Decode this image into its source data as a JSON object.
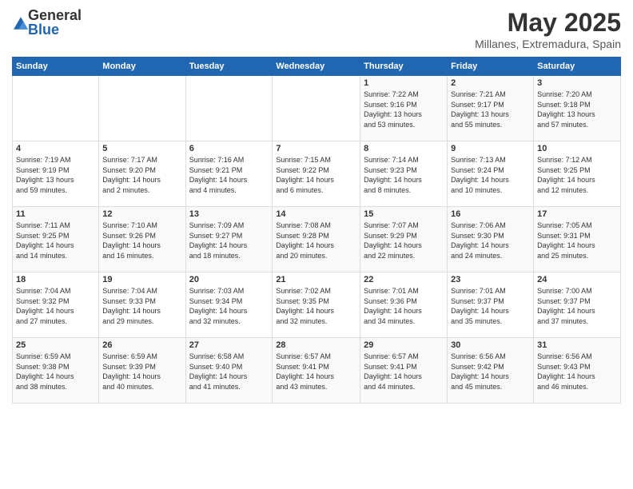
{
  "header": {
    "logo_general": "General",
    "logo_blue": "Blue",
    "month": "May 2025",
    "location": "Millanes, Extremadura, Spain"
  },
  "days_of_week": [
    "Sunday",
    "Monday",
    "Tuesday",
    "Wednesday",
    "Thursday",
    "Friday",
    "Saturday"
  ],
  "weeks": [
    [
      {
        "day": "",
        "content": ""
      },
      {
        "day": "",
        "content": ""
      },
      {
        "day": "",
        "content": ""
      },
      {
        "day": "",
        "content": ""
      },
      {
        "day": "1",
        "content": "Sunrise: 7:22 AM\nSunset: 9:16 PM\nDaylight: 13 hours\nand 53 minutes."
      },
      {
        "day": "2",
        "content": "Sunrise: 7:21 AM\nSunset: 9:17 PM\nDaylight: 13 hours\nand 55 minutes."
      },
      {
        "day": "3",
        "content": "Sunrise: 7:20 AM\nSunset: 9:18 PM\nDaylight: 13 hours\nand 57 minutes."
      }
    ],
    [
      {
        "day": "4",
        "content": "Sunrise: 7:19 AM\nSunset: 9:19 PM\nDaylight: 13 hours\nand 59 minutes."
      },
      {
        "day": "5",
        "content": "Sunrise: 7:17 AM\nSunset: 9:20 PM\nDaylight: 14 hours\nand 2 minutes."
      },
      {
        "day": "6",
        "content": "Sunrise: 7:16 AM\nSunset: 9:21 PM\nDaylight: 14 hours\nand 4 minutes."
      },
      {
        "day": "7",
        "content": "Sunrise: 7:15 AM\nSunset: 9:22 PM\nDaylight: 14 hours\nand 6 minutes."
      },
      {
        "day": "8",
        "content": "Sunrise: 7:14 AM\nSunset: 9:23 PM\nDaylight: 14 hours\nand 8 minutes."
      },
      {
        "day": "9",
        "content": "Sunrise: 7:13 AM\nSunset: 9:24 PM\nDaylight: 14 hours\nand 10 minutes."
      },
      {
        "day": "10",
        "content": "Sunrise: 7:12 AM\nSunset: 9:25 PM\nDaylight: 14 hours\nand 12 minutes."
      }
    ],
    [
      {
        "day": "11",
        "content": "Sunrise: 7:11 AM\nSunset: 9:25 PM\nDaylight: 14 hours\nand 14 minutes."
      },
      {
        "day": "12",
        "content": "Sunrise: 7:10 AM\nSunset: 9:26 PM\nDaylight: 14 hours\nand 16 minutes."
      },
      {
        "day": "13",
        "content": "Sunrise: 7:09 AM\nSunset: 9:27 PM\nDaylight: 14 hours\nand 18 minutes."
      },
      {
        "day": "14",
        "content": "Sunrise: 7:08 AM\nSunset: 9:28 PM\nDaylight: 14 hours\nand 20 minutes."
      },
      {
        "day": "15",
        "content": "Sunrise: 7:07 AM\nSunset: 9:29 PM\nDaylight: 14 hours\nand 22 minutes."
      },
      {
        "day": "16",
        "content": "Sunrise: 7:06 AM\nSunset: 9:30 PM\nDaylight: 14 hours\nand 24 minutes."
      },
      {
        "day": "17",
        "content": "Sunrise: 7:05 AM\nSunset: 9:31 PM\nDaylight: 14 hours\nand 25 minutes."
      }
    ],
    [
      {
        "day": "18",
        "content": "Sunrise: 7:04 AM\nSunset: 9:32 PM\nDaylight: 14 hours\nand 27 minutes."
      },
      {
        "day": "19",
        "content": "Sunrise: 7:04 AM\nSunset: 9:33 PM\nDaylight: 14 hours\nand 29 minutes."
      },
      {
        "day": "20",
        "content": "Sunrise: 7:03 AM\nSunset: 9:34 PM\nDaylight: 14 hours\nand 32 minutes."
      },
      {
        "day": "21",
        "content": "Sunrise: 7:02 AM\nSunset: 9:35 PM\nDaylight: 14 hours\nand 32 minutes."
      },
      {
        "day": "22",
        "content": "Sunrise: 7:01 AM\nSunset: 9:36 PM\nDaylight: 14 hours\nand 34 minutes."
      },
      {
        "day": "23",
        "content": "Sunrise: 7:01 AM\nSunset: 9:37 PM\nDaylight: 14 hours\nand 35 minutes."
      },
      {
        "day": "24",
        "content": "Sunrise: 7:00 AM\nSunset: 9:37 PM\nDaylight: 14 hours\nand 37 minutes."
      }
    ],
    [
      {
        "day": "25",
        "content": "Sunrise: 6:59 AM\nSunset: 9:38 PM\nDaylight: 14 hours\nand 38 minutes."
      },
      {
        "day": "26",
        "content": "Sunrise: 6:59 AM\nSunset: 9:39 PM\nDaylight: 14 hours\nand 40 minutes."
      },
      {
        "day": "27",
        "content": "Sunrise: 6:58 AM\nSunset: 9:40 PM\nDaylight: 14 hours\nand 41 minutes."
      },
      {
        "day": "28",
        "content": "Sunrise: 6:57 AM\nSunset: 9:41 PM\nDaylight: 14 hours\nand 43 minutes."
      },
      {
        "day": "29",
        "content": "Sunrise: 6:57 AM\nSunset: 9:41 PM\nDaylight: 14 hours\nand 44 minutes."
      },
      {
        "day": "30",
        "content": "Sunrise: 6:56 AM\nSunset: 9:42 PM\nDaylight: 14 hours\nand 45 minutes."
      },
      {
        "day": "31",
        "content": "Sunrise: 6:56 AM\nSunset: 9:43 PM\nDaylight: 14 hours\nand 46 minutes."
      }
    ]
  ]
}
